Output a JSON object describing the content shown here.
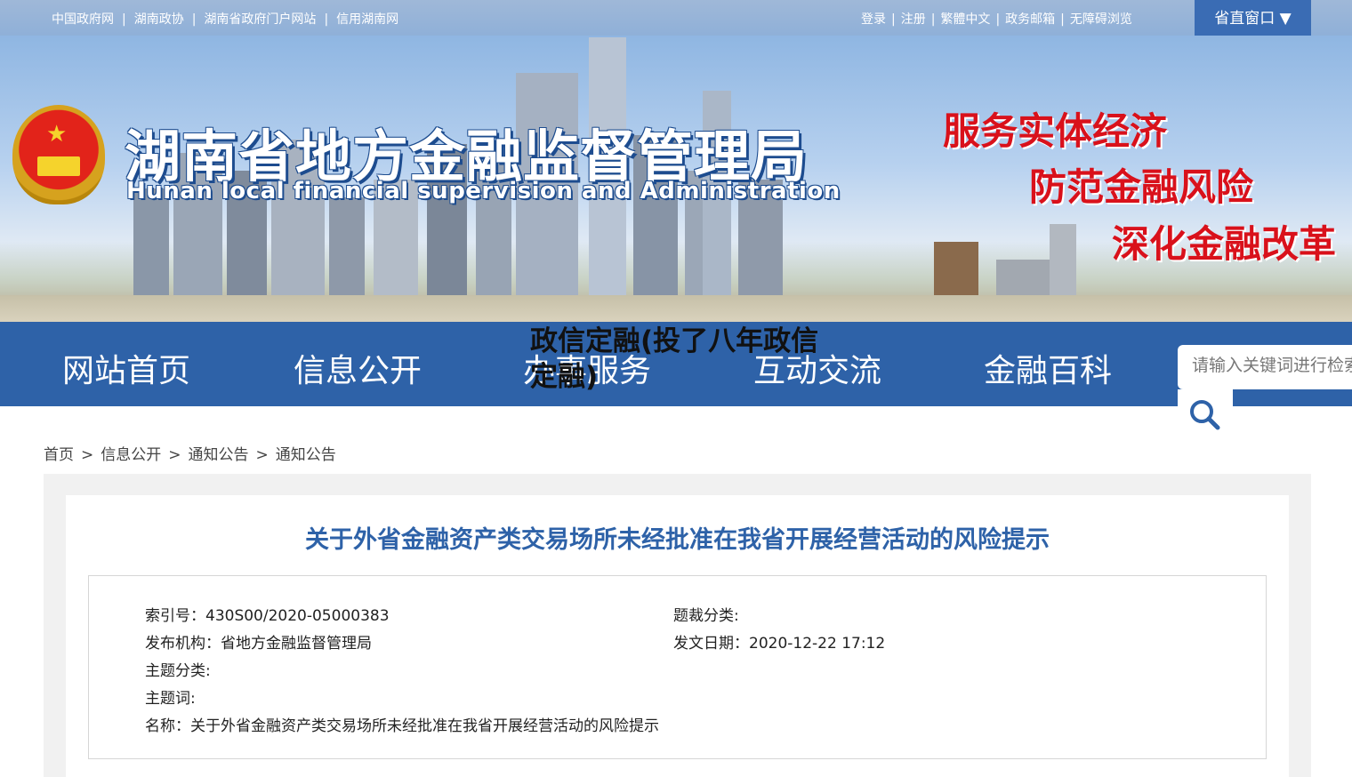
{
  "topbar": {
    "links": [
      "中国政府网",
      "湖南政协",
      "湖南省政府门户网站",
      "信用湖南网"
    ],
    "user_links": [
      "登录",
      "注册",
      "繁體中文",
      "政务邮箱",
      "无障碍浏览"
    ],
    "province_window": "省直窗口 ▼"
  },
  "banner": {
    "title": "湖南省地方金融监督管理局",
    "subtitle": "Hunan local financial supervision and Administration",
    "slogans": [
      "服务实体经济",
      "防范金融风险",
      "深化金融改革"
    ]
  },
  "nav": {
    "items": [
      "网站首页",
      "信息公开",
      "办事服务",
      "互动交流",
      "金融百科"
    ],
    "search_placeholder": "请输入关键词进行检索"
  },
  "overlay_title": "政信定融(投了八年政信定融)",
  "breadcrumb": [
    "首页",
    "信息公开",
    "通知公告",
    "通知公告"
  ],
  "article": {
    "title": "关于外省金融资产类交易场所未经批准在我省开展经营活动的风险提示",
    "meta": {
      "index_no": "索引号：430S00/2020-05000383",
      "genre": "题裁分类:",
      "publisher": "发布机构：省地方金融监督管理局",
      "issue_date": "发文日期：2020-12-22 17:12",
      "topic_category": "主题分类:",
      "keywords": "主题词:",
      "name": "名称：关于外省金融资产类交易场所未经批准在我省开展经营活动的风险提示"
    }
  },
  "colors": {
    "nav_blue": "#2e62a8",
    "title_blue": "#2e62a8",
    "slogan_red": "#d9111b",
    "topbar": "#9fb8d8"
  }
}
